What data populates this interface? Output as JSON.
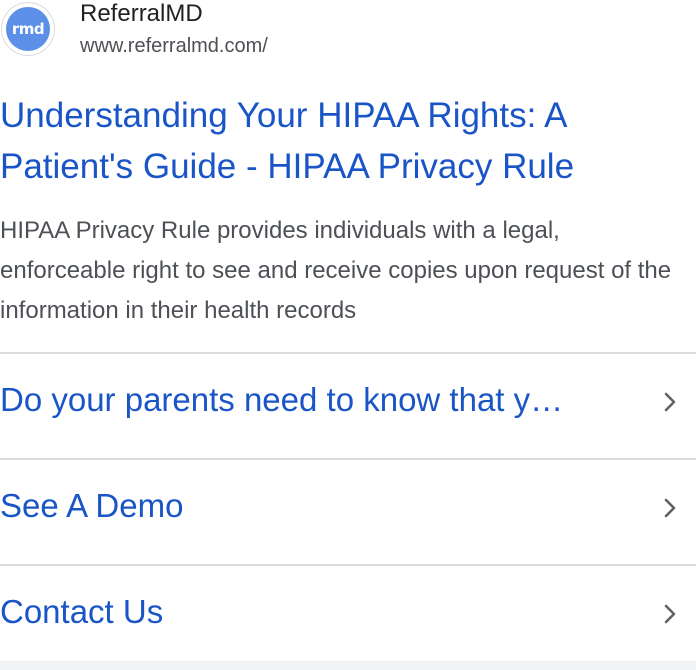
{
  "source": {
    "favicon_text": "rmd",
    "site_name": "ReferralMD",
    "url": "www.referralmd.com/"
  },
  "result": {
    "title": "Understanding Your HIPAA Rights: A Patient's Guide - HIPAA Privacy Rule",
    "snippet": "HIPAA Privacy Rule provides individuals with a legal, enforceable right to see and receive copies upon request of the information in their health records"
  },
  "sitelinks": [
    {
      "label": "Do your parents need to know that y…",
      "icon": "chevron-right-icon"
    },
    {
      "label": "See A Demo",
      "icon": "chevron-right-icon"
    },
    {
      "label": "Contact Us",
      "icon": "chevron-right-icon"
    }
  ],
  "colors": {
    "link": "#1a55c8",
    "text": "#4d5156",
    "divider": "#dadce0",
    "favicon_bg": "#5b8fe8"
  }
}
